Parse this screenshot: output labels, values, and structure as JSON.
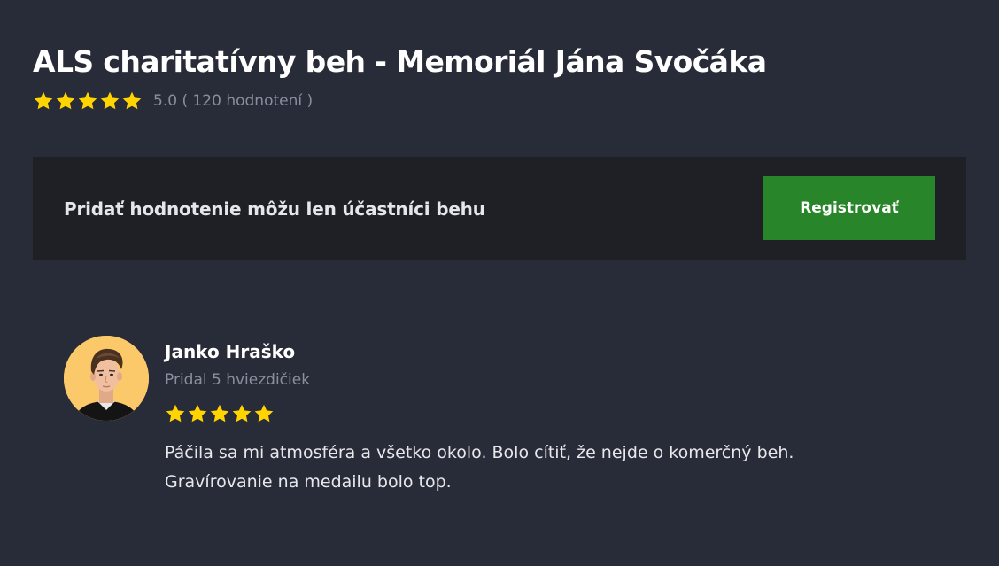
{
  "event": {
    "title": "ALS charitatívny beh - Memoriál Jána Svočáka",
    "rating_value": "5.0",
    "rating_text": "5.0 ( 120 hodnotení )",
    "star_count": 5
  },
  "notice": {
    "text": "Pridať hodnotenie môžu len účastníci behu",
    "button_label": "Registrovať"
  },
  "review": {
    "author": "Janko Hraško",
    "subtitle": "Pridal 5 hviezdičiek",
    "stars": 5,
    "text_line1": "Páčila sa mi atmosféra a všetko okolo. Bolo cítiť, že nejde o komerčný beh.",
    "text_line2": "Gravírovanie na medailu bolo top."
  },
  "colors": {
    "background": "#282b38",
    "panel": "#1f2026",
    "accent_green": "#28852a",
    "star": "#ffd400",
    "muted_text": "#8b8e9c"
  },
  "icons": {
    "star": "star-icon",
    "avatar": "avatar"
  }
}
